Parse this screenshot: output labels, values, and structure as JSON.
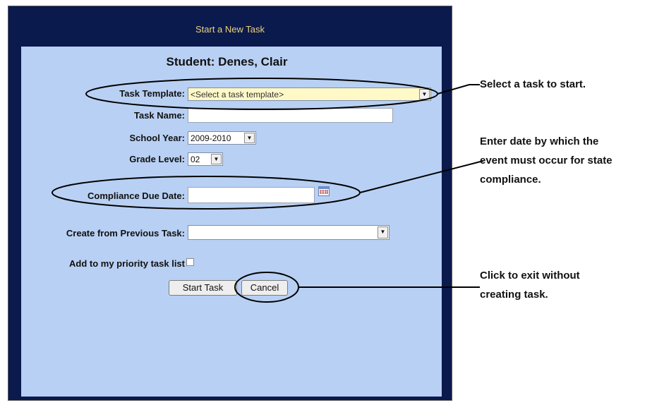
{
  "dialog": {
    "title": "Start a New Task",
    "student_label": "Student: Denes, Clair"
  },
  "form": {
    "task_template": {
      "label": "Task Template:",
      "value": "<Select a task template>"
    },
    "task_name": {
      "label": "Task Name:",
      "value": ""
    },
    "school_year": {
      "label": "School Year:",
      "value": "2009-2010"
    },
    "grade_level": {
      "label": "Grade Level:",
      "value": "02"
    },
    "compliance_due_date": {
      "label": "Compliance Due Date:",
      "value": ""
    },
    "create_from_previous": {
      "label": "Create from Previous Task:",
      "value": ""
    },
    "priority_list": {
      "label": "Add to my priority task list",
      "checked": false
    }
  },
  "buttons": {
    "start_task": "Start Task",
    "cancel": "Cancel"
  },
  "annotations": {
    "select_task": "Select a task to start.",
    "due_date_line1": "Enter date by which the",
    "due_date_line2": "event must occur for state",
    "due_date_line3": "compliance.",
    "exit_line1": "Click to exit without",
    "exit_line2": "creating task."
  },
  "colors": {
    "dialog_bg": "#0b1a4d",
    "panel_bg": "#b8d0f3",
    "title_text": "#e8d27a",
    "template_select_bg": "#fff9c8"
  },
  "icons": {
    "calendar": "calendar-icon",
    "dropdown": "chevron-down-icon"
  }
}
